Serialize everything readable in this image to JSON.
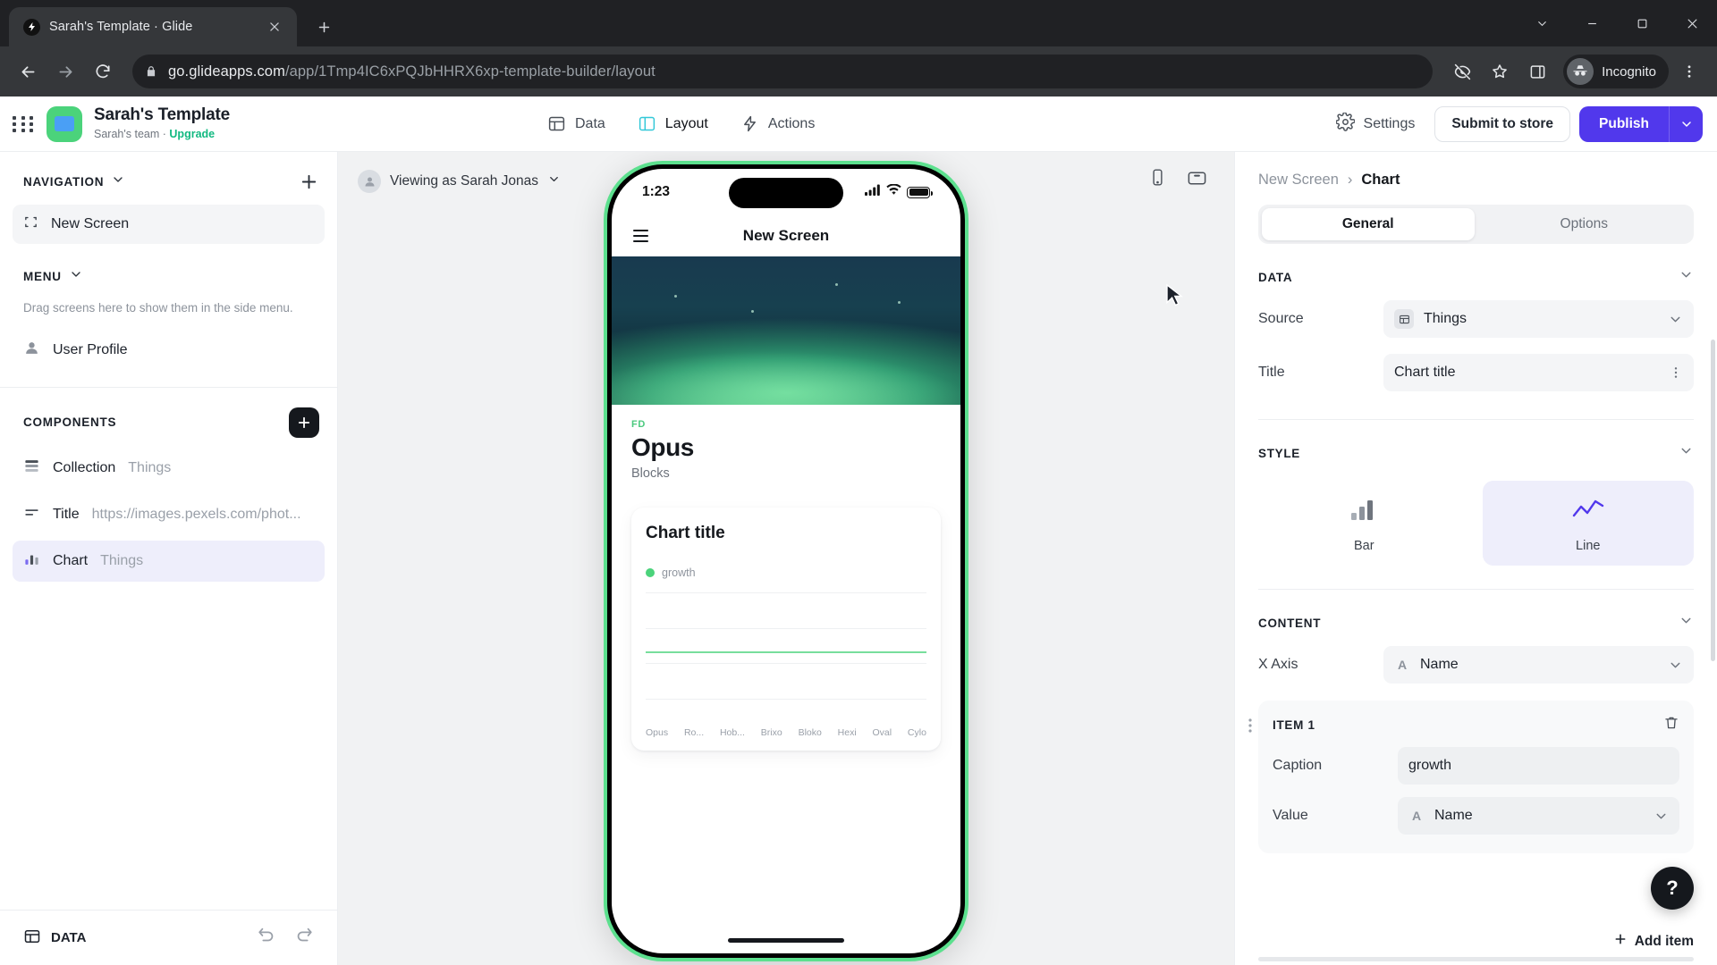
{
  "browser": {
    "tab": {
      "title": "Sarah's Template · Glide",
      "favicon": "glide-bolt-icon",
      "close": "×"
    },
    "new_tab_label": "+",
    "window_controls": {
      "minimize": "⌄",
      "restore": "—",
      "maximize": "▢",
      "close": "✕"
    },
    "toolbar": {
      "back": "back-arrow-icon",
      "forward": "forward-arrow-icon",
      "reload": "reload-icon",
      "url_host": "go.glideapps.com",
      "url_path": "/app/1Tmp4IC6xPQJbHHRX6xp-template-builder/layout",
      "lock": "lock-icon",
      "tracking_off": "eye-off-icon",
      "bookmark": "star-icon",
      "side_panel": "side-panel-icon",
      "profile_label": "Incognito",
      "menu": "kebab-menu-icon"
    }
  },
  "appbar": {
    "grid": "apps-grid-icon",
    "app_name": "Sarah's Template",
    "team": "Sarah's team",
    "separator": "·",
    "upgrade": "Upgrade",
    "nav": [
      {
        "label": "Data",
        "icon": "table-icon",
        "active": false
      },
      {
        "label": "Layout",
        "icon": "layout-icon",
        "active": true
      },
      {
        "label": "Actions",
        "icon": "bolt-icon",
        "active": false
      }
    ],
    "settings": "Settings",
    "submit_to_store": "Submit to store",
    "publish": "Publish",
    "publish_caret": "chevron-down-icon"
  },
  "left": {
    "navigation_title": "NAVIGATION",
    "navigation_add": "+",
    "screens": [
      {
        "label": "New Screen",
        "icon": "screen-frame-icon",
        "selected": true
      }
    ],
    "menu_title": "MENU",
    "menu_hint": "Drag screens here to show them in the side menu.",
    "menu_items": [
      {
        "label": "User Profile",
        "icon": "person-icon"
      }
    ],
    "components_title": "COMPONENTS",
    "components_add": "+",
    "components": [
      {
        "label": "Collection",
        "sub": "Things",
        "icon": "collection-icon",
        "selected": false
      },
      {
        "label": "Title",
        "sub": "https://images.pexels.com/phot...",
        "icon": "title-icon",
        "selected": false
      },
      {
        "label": "Chart",
        "sub": "Things",
        "icon": "chart-icon",
        "selected": true
      }
    ],
    "footer": {
      "data_label": "DATA",
      "data_icon": "table-icon",
      "undo": "undo-icon",
      "redo": "redo-icon"
    }
  },
  "canvas": {
    "viewing_as": "Viewing as Sarah Jonas",
    "viewing_caret": "chevron-down-icon",
    "device_phone": "phone-icon",
    "device_tablet": "tablet-icon",
    "phone": {
      "time": "1:23",
      "signal": "signal-icon",
      "wifi": "wifi-icon",
      "battery": "battery-icon",
      "menu": "hamburger-icon",
      "screen_title": "New Screen",
      "eyebrow": "FD",
      "heading": "Opus",
      "subheading": "Blocks"
    }
  },
  "chart_data": {
    "type": "line",
    "title": "Chart title",
    "categories": [
      "Opus",
      "Ro...",
      "Hob...",
      "Brixo",
      "Bloko",
      "Hexi",
      "Oval",
      "Cylo"
    ],
    "series": [
      {
        "name": "growth",
        "color": "#4bd37b",
        "values": [
          1,
          1,
          1,
          1,
          1,
          1,
          1,
          1
        ]
      }
    ],
    "legend": [
      "growth"
    ],
    "legend_position": "top-left",
    "xlabel": "",
    "ylabel": "",
    "ylim": [
      0,
      2
    ],
    "grid": true
  },
  "right": {
    "breadcrumb": {
      "parent": "New Screen",
      "separator": "›",
      "current": "Chart"
    },
    "tabs": [
      {
        "label": "General",
        "active": true
      },
      {
        "label": "Options",
        "active": false
      }
    ],
    "data_section": {
      "title": "DATA",
      "collapse": "chevron-down-icon",
      "source_label": "Source",
      "source_value": "Things",
      "source_icon": "table-icon",
      "source_caret": "chevron-down-icon",
      "title_label": "Title",
      "title_value": "Chart title",
      "title_menu": "kebab-menu-icon"
    },
    "style_section": {
      "title": "STYLE",
      "collapse": "chevron-down-icon",
      "options": [
        {
          "label": "Bar",
          "icon": "bar-chart-icon",
          "active": false
        },
        {
          "label": "Line",
          "icon": "line-chart-icon",
          "active": true
        }
      ]
    },
    "content_section": {
      "title": "CONTENT",
      "collapse": "chevron-down-icon",
      "x_axis_label": "X Axis",
      "x_axis_value": "Name",
      "x_axis_type": "A",
      "x_axis_caret": "chevron-down-icon"
    },
    "item": {
      "title": "ITEM 1",
      "drag_handle": "drag-dots-icon",
      "delete": "trash-icon",
      "caption_label": "Caption",
      "caption_value": "growth",
      "value_label": "Value",
      "value_value": "Name",
      "value_type": "A",
      "value_caret": "chevron-down-icon"
    },
    "add_item": "Add item",
    "add_item_icon": "plus-icon",
    "help": "?"
  },
  "colors": {
    "brand_green": "#4bd37b",
    "publish_purple": "#5138ec",
    "accent_lavender": "#eeeefb",
    "upgrade_teal": "#12b981",
    "chrome_dark": "#35373a",
    "chrome_darker": "#202124"
  }
}
